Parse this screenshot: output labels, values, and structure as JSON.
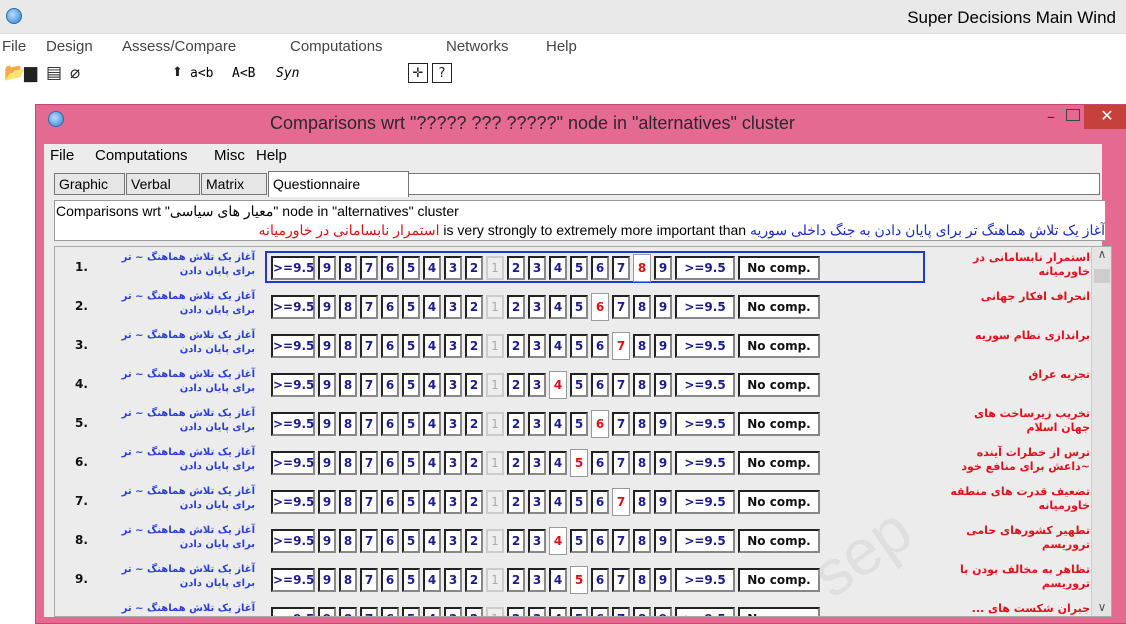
{
  "main_window": {
    "title": "Super Decisions Main Wind",
    "menu": [
      "File",
      "Design",
      "Assess/Compare",
      "Computations",
      "Networks",
      "Help"
    ],
    "toolbar_text": [
      "a<b",
      "A<B",
      "Syn"
    ]
  },
  "dialog": {
    "title": "Comparisons wrt \"????? ??? ?????\" node in \"alternatives\" cluster",
    "menu": [
      "File",
      "Computations",
      "Misc",
      "Help"
    ],
    "tabs": [
      "Graphic",
      "Verbal",
      "Matrix",
      "Questionnaire"
    ],
    "active_tab": "Questionnaire",
    "info": {
      "prefix": "Comparisons wrt ",
      "node_name": "\"معیار های سیاسی\"",
      "suffix": " node in \"alternatives\" cluster",
      "sentence_left": "استمرار نابسامانی در خاورمیانه",
      "sentence_middle": "is very strongly to extremely more important than",
      "sentence_right": "آغاز یک تلاش هماهنگ تر برای پایان دادن به جنگ داخلی سوریه"
    },
    "scale_left": [
      ">=9.5",
      "9",
      "8",
      "7",
      "6",
      "5",
      "4",
      "3",
      "2"
    ],
    "scale_mid": "1",
    "scale_right": [
      "2",
      "3",
      "4",
      "5",
      "6",
      "7",
      "8",
      "9",
      ">=9.5"
    ],
    "no_comp": "No comp.",
    "left_item": "آغاز یک تلاش هماهنگ ~ تر برای پایان دادن",
    "rows": [
      {
        "num": "1.",
        "right": "استمرار نابسامانی در خاورمیانه",
        "chosen": "8"
      },
      {
        "num": "2.",
        "right": "انحراف افکار جهانی",
        "chosen": "6"
      },
      {
        "num": "3.",
        "right": "براندازی نظام سوریه",
        "chosen": "7"
      },
      {
        "num": "4.",
        "right": "تجزیه عراق",
        "chosen": "4"
      },
      {
        "num": "5.",
        "right": "تخریب زیرساخت های جهان اسلام",
        "chosen": "6"
      },
      {
        "num": "6.",
        "right": "ترس از خطرات آینده ~داعش برای منافع خود",
        "chosen": "5"
      },
      {
        "num": "7.",
        "right": "تضعیف قدرت های منطقه خاورمیانه",
        "chosen": "7"
      },
      {
        "num": "8.",
        "right": "تطهیر کشورهای حامی تروریسم",
        "chosen": "4"
      },
      {
        "num": "9.",
        "right": "تظاهر به مخالف بودن با تروریسم",
        "chosen": "5"
      },
      {
        "num": "",
        "right": "جبران شکست های ...",
        "chosen": ""
      }
    ]
  },
  "colors": {
    "dialog_frame": "#e56a92",
    "close_button": "#c6413c",
    "selection_border": "#1a3cc7",
    "red_text": "#d11",
    "blue_text": "#1b2dc4"
  }
}
